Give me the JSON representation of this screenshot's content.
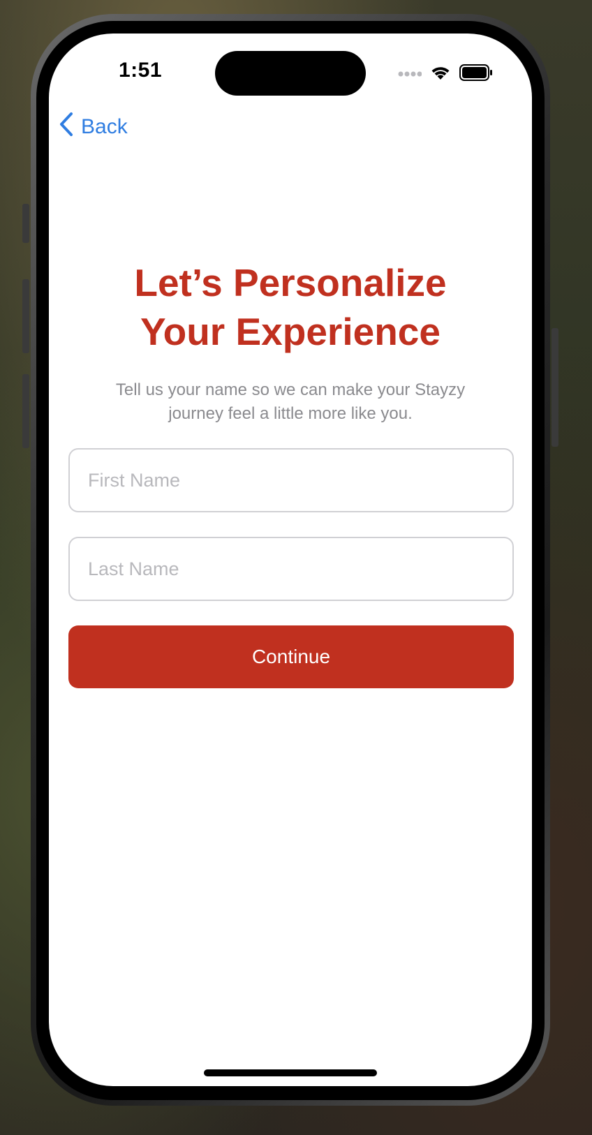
{
  "status_bar": {
    "time": "1:51",
    "signal_icon": "cellular-dots-icon",
    "wifi_icon": "wifi-icon",
    "battery_icon": "battery-full-icon"
  },
  "nav": {
    "back_label": "Back",
    "back_icon": "chevron-left-icon"
  },
  "header": {
    "title_line1": "Let’s Personalize",
    "title_line2": "Your Experience",
    "subtitle_line1": "Tell us your name so we can make your Stayzy",
    "subtitle_line2": "journey feel a little more like you."
  },
  "form": {
    "first_name": {
      "value": "",
      "placeholder": "First Name"
    },
    "last_name": {
      "value": "",
      "placeholder": "Last Name"
    },
    "continue_label": "Continue"
  },
  "colors": {
    "accent": "#c0301f",
    "link": "#2f7de1",
    "subtitle": "#8a8a8e",
    "field_border": "#d0d0d4",
    "placeholder": "#b8b8bc"
  }
}
